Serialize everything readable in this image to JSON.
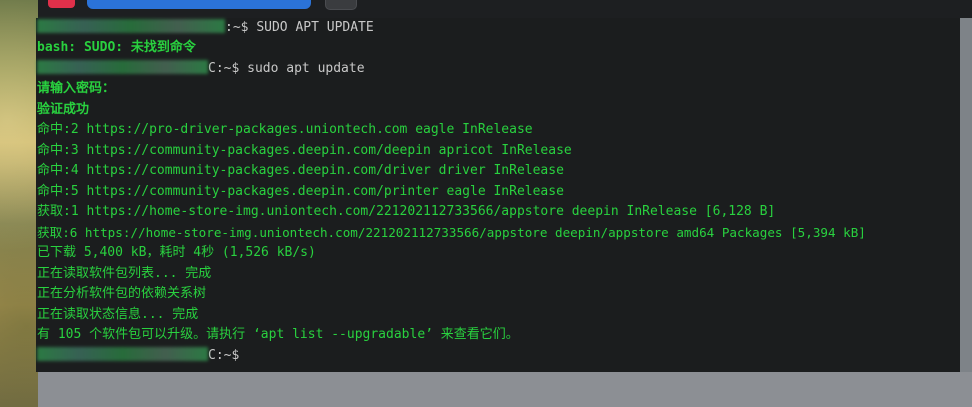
{
  "terminal": {
    "lines": [
      {
        "prompt_suffix": ":~$ ",
        "command": "SUDO APT UPDATE"
      },
      {
        "text": "bash: SUDO: 未找到命令"
      },
      {
        "prompt_suffix": "C:~$ ",
        "command": "sudo apt update"
      },
      {
        "text": "请输入密码："
      },
      {
        "text": "验证成功"
      },
      {
        "text": "命中:2 https://pro-driver-packages.uniontech.com eagle InRelease"
      },
      {
        "text": "命中:3 https://community-packages.deepin.com/deepin apricot InRelease"
      },
      {
        "text": "命中:4 https://community-packages.deepin.com/driver driver InRelease"
      },
      {
        "text": "命中:5 https://community-packages.deepin.com/printer eagle InRelease"
      },
      {
        "text": "获取:1 https://home-store-img.uniontech.com/221202112733566/appstore deepin InRelease [6,128 B]"
      },
      {
        "text": "获取:6 https://home-store-img.uniontech.com/221202112733566/appstore deepin/appstore amd64 Packages [5,394 kB]"
      },
      {
        "text": "已下载 5,400 kB，耗时 4秒 (1,526 kB/s)"
      },
      {
        "text": "正在读取软件包列表... 完成"
      },
      {
        "text": "正在分析软件包的依赖关系树"
      },
      {
        "text": "正在读取状态信息... 完成"
      },
      {
        "text": "有 105 个软件包可以升级。请执行 ‘apt list --upgradable’ 来查看它们。"
      },
      {
        "prompt_suffix": "C:~$ ",
        "command": ""
      }
    ]
  },
  "colors": {
    "text_green": "#29d13f",
    "command_gray": "#c8c8c8",
    "background": "#1b1d1e",
    "tab_blue": "#2b73d8",
    "tab_red": "#e0304a"
  }
}
